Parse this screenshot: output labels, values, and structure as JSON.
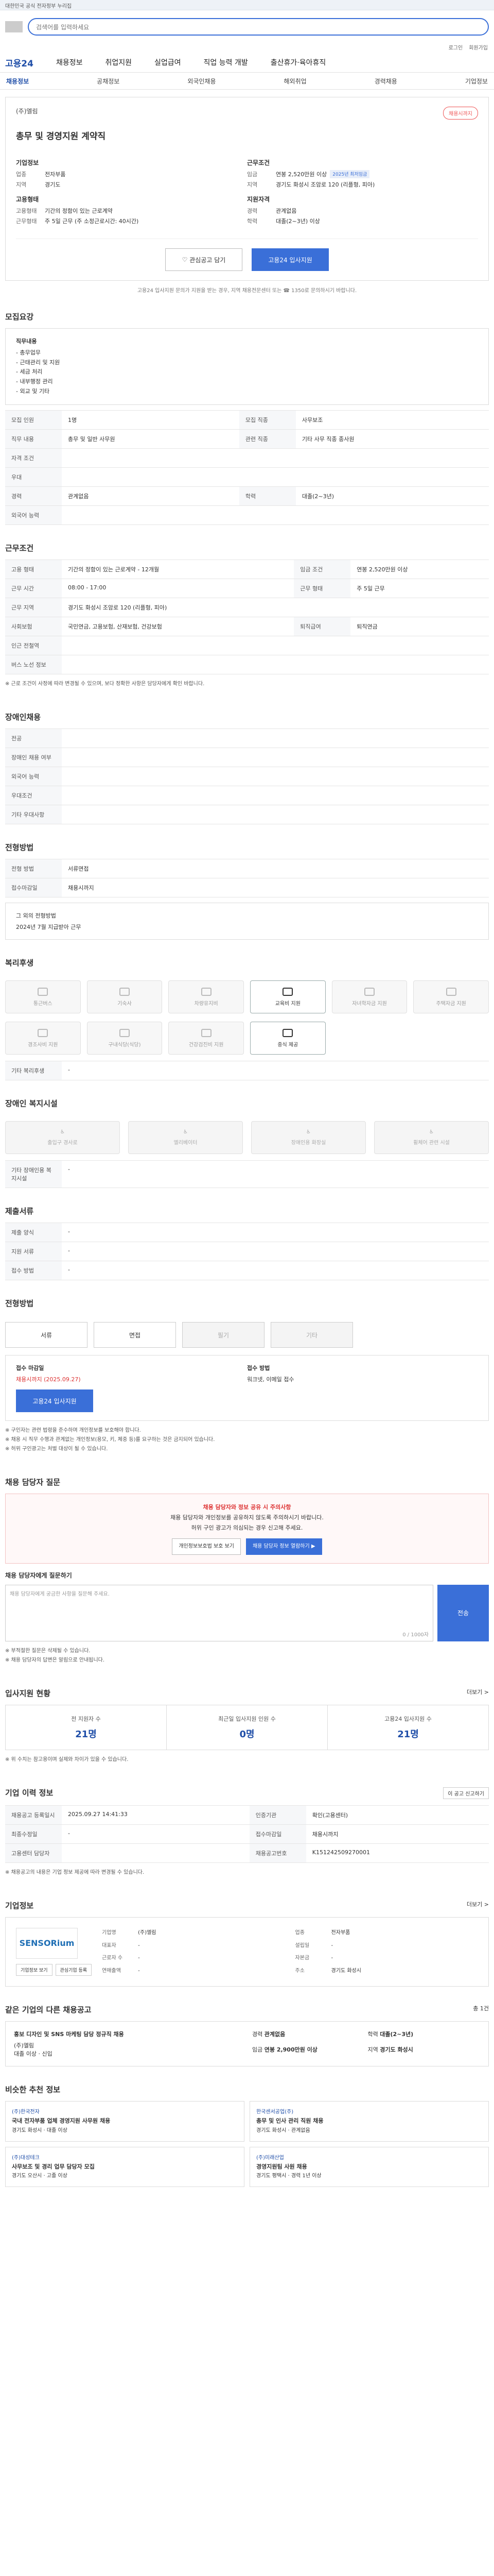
{
  "banner": "대한민국 공식 전자정부 누리집",
  "search": {
    "placeholder": "검색어를 입력하세요"
  },
  "util": [
    "로그인",
    "회원가입"
  ],
  "brand": {
    "logo": "고용24",
    "nav": [
      "채용정보",
      "취업지원",
      "실업급여",
      "직업 능력 개발",
      "출산휴가·육아휴직"
    ]
  },
  "subnav": [
    "채용정보",
    "공채정보",
    "외국인채용",
    "해외취업",
    "경력채용",
    "기업정보"
  ],
  "job": {
    "company": "(주)엘림",
    "badge": "채용시까지",
    "title": "총무 및 경영지원 계약직",
    "sect_company": "기업정보",
    "company_label": "업종",
    "company_val": "전자부품",
    "cn_label": "지역",
    "cn_val": "경기도",
    "sect_cond": "근무조건",
    "wage_label": "임금",
    "wage_val": "연봉 2,520만원 이상",
    "wage_tag": "2025년 최저임금",
    "loc_label": "지역",
    "loc_val": "경기도 화성시 조암로 120 (리플형, 피아)",
    "sect_type": "고용형태",
    "type_label": "고용형태",
    "type_val": "기간의 정함이 있는 근로계약",
    "form_label": "근무형태",
    "form_val": "주 5일 근무 (주 소정근로시간: 40시간)",
    "sect_req": "지원자격",
    "career_label": "경력",
    "career_val": "관계없음",
    "edu_label": "학력",
    "edu_val": "대졸(2~3년) 이상",
    "btn_interest": "관심공고 담기",
    "btn_apply": "고용24 입사지원",
    "note": "고용24 입사지원 문의가 지원을 받는 경우, 지역 채용전문센터 또는 ☎ 1350로 문의하시기 바랍니다."
  },
  "recruit": {
    "title": "모집요강",
    "duty_label": "직무내용",
    "duty_lines": [
      "- 총무업무",
      "- 근태관리 및 지원",
      "- 세금 처리",
      "- 내부행정 관리",
      "- 외교 및 기타"
    ],
    "rows": [
      [
        "모집 인원",
        "1명",
        "모집 직종",
        "사무보조"
      ],
      [
        "직무 내용",
        "총무 및 일반 사무원",
        "관련 직종",
        "기타 사무 직종 종사원"
      ],
      [
        "자격 조건",
        "",
        null,
        null
      ],
      [
        "우대",
        "",
        null,
        null
      ],
      [
        "경력",
        "관계없음",
        "학력",
        "대졸(2~3년)"
      ],
      [
        "외국어 능력",
        "",
        null,
        null
      ]
    ]
  },
  "cond": {
    "title": "근무조건",
    "rows": [
      [
        "고용 형태",
        "기간의 정함이 있는 근로계약 - 12개월",
        "임금 조건",
        "연봉 2,520만원 이상"
      ],
      [
        "근무 시간",
        "08:00 - 17:00",
        "근무 형태",
        "주 5일 근무"
      ],
      [
        "근무 지역",
        "경기도 화성시 조암로 120 (리플형, 피아)",
        "",
        ""
      ],
      [
        "사회보험",
        "국민연금, 고용보험, 산재보험, 건강보험",
        "퇴직급여",
        "퇴직연금"
      ],
      [
        "인근 전철역",
        "",
        "",
        ""
      ],
      [
        "버스 노선 정보",
        "",
        "",
        ""
      ]
    ],
    "note": "※ 근로 조건이 사정에 따라 변경될 수 있으며, 보다 정확한 사항은 담당자에게 확인 바랍니다."
  },
  "disability": {
    "title": "장애인채용",
    "rows": [
      [
        "전공",
        ""
      ],
      [
        "장애인 채용 여부",
        ""
      ],
      [
        "외국어 능력",
        ""
      ],
      [
        "우대조건",
        ""
      ],
      [
        "기타 우대사항",
        ""
      ]
    ]
  },
  "process": {
    "title": "전형방법",
    "rows": [
      [
        "전형 방법",
        "서류면접"
      ],
      [
        "접수마감일",
        "채용시까지"
      ]
    ],
    "note_title": "그 외의 전형방법",
    "note_body": "2024년 7월 지급받아 근무"
  },
  "welfare": {
    "title": "복리후생",
    "items": [
      "통근버스",
      "기숙사",
      "차량유지비",
      "교육비 지원",
      "자녀학자금 지원",
      "주택자금 지원",
      "경조사비 지원",
      "구내식당(식당)",
      "건강검진비 지원",
      "중식 제공"
    ],
    "on": [
      3,
      9
    ],
    "other_label": "기타 복리후생",
    "other_val": "-"
  },
  "disab_welfare": {
    "title": "장애인 복지시설",
    "items": [
      "출입구 경사로",
      "엘리베이터",
      "장애인용 화장실",
      "휠체어 관련 시설"
    ],
    "other_label": "기타 장애인용 복지시설",
    "other_val": "-"
  },
  "docs": {
    "title": "제출서류",
    "rows": [
      [
        "제출 양식",
        "-"
      ],
      [
        "지원 서류",
        "-"
      ],
      [
        "접수 방법",
        "-"
      ]
    ]
  },
  "apply": {
    "title": "전형방법",
    "methods": [
      "서류",
      "면접",
      "필기",
      "기타"
    ],
    "deadline_label": "접수 마감일",
    "deadline_val": "채용시까지 (2025.09.27)",
    "way_label": "접수 방법",
    "way_val": "워크넷, 이메일 접수",
    "btn_apply": "고용24 입사지원",
    "bullets": [
      "※ 구인자는 관련 법령을 준수하며 개인정보를 보호해야 합니다.",
      "※ 채용 시 직무 수행과 관계없는 개인정보(용모, 키, 체중 등)를 요구하는 것은 금지되어 있습니다.",
      "※ 허위 구인광고는 처벌 대상이 될 수 있습니다."
    ]
  },
  "qa": {
    "title": "채용 담당자 질문",
    "banner_line1": "채용 담당자와 정보 공유 시 주의사항",
    "banner_line2": "채용 담당자와 개인정보를 공유하지 않도록 주의하시기 바랍니다.",
    "banner_line3": "허위 구인 광고가 의심되는 경우 신고해 주세요.",
    "btns": [
      "개인정보보호법 보호 보기",
      "채용 담당자 정보 열람하기 ▶"
    ],
    "question_label": "채용 담당자에게 질문하기",
    "question_placeholder": "채용 담당자에게 궁금한 사항을 질문해 주세요.",
    "counter": "0 / 1000자",
    "send": "전송",
    "notes": [
      "※ 부적절한 질문은 삭제될 수 있습니다.",
      "※ 채용 담당자의 답변은 알림으로 안내됩니다."
    ]
  },
  "stats": {
    "title": "입사지원 현황",
    "more": "더보기 >",
    "items": [
      {
        "label": "전 지원자 수",
        "value": "21명"
      },
      {
        "label": "최근일 입사지원 인원 수",
        "value": "0명"
      },
      {
        "label": "고용24 입사지원 수",
        "value": "21명"
      }
    ],
    "note": "※ 위 수치는 참고용이며 실제와 차이가 있을 수 있습니다."
  },
  "regi": {
    "title": "기업 이력 정보",
    "btn": "이 공고 신고하기",
    "rows": [
      [
        "채용공고 등록일시",
        "2025.09.27 14:41:33",
        "인증기관",
        "확인(고용센터)"
      ],
      [
        "최종수정일",
        "-",
        "접수마감일",
        "채용시까지"
      ],
      [
        "고용센터 담당자",
        "",
        "채용공고번호",
        "K151242509270001"
      ]
    ],
    "note": "※ 채용공고의 내용은 기업 정보 제공에 따라 변경될 수 있습니다."
  },
  "company": {
    "title": "기업정보",
    "more": "더보기 >",
    "logo": "SENSORium",
    "btns": [
      "기업정보 보기",
      "관심기업 등록"
    ],
    "fields": [
      [
        "기업명",
        "(주)엘림"
      ],
      [
        "업종",
        "전자부품"
      ],
      [
        "대표자",
        "-"
      ],
      [
        "설립일",
        "-"
      ],
      [
        "근로자 수",
        "-"
      ],
      [
        "자본금",
        "-"
      ],
      [
        "연매출액",
        "-"
      ],
      [
        "주소",
        "경기도 화성시"
      ]
    ]
  },
  "other": {
    "title": "같은 기업의 다른 채용공고",
    "subtitle": "총 1건",
    "left_title": "홍보 디자인 및 SNS 마케팅 담당 정규직 채용",
    "left_lines": [
      "(주)엘림",
      "대졸 이상 · 신입"
    ],
    "right": [
      "경력",
      "관계없음",
      "학력",
      "대졸(2~3년)",
      "임금",
      "연봉 2,900만원 이상",
      "지역",
      "경기도 화성시"
    ]
  },
  "similar": {
    "title": "비슷한 추천 정보",
    "jobs": [
      {
        "co": "(주)한국전자",
        "t": "국내 전자부품 업체 경영지원 사무원 채용",
        "meta": "경기도 화성시 · 대졸 이상"
      },
      {
        "co": "한국센서공업(주)",
        "t": "총무 및 인사 관리 직원 채용",
        "meta": "경기도 화성시 · 관계없음"
      },
      {
        "co": "(주)대성테크",
        "t": "사무보조 및 경리 업무 담당자 모집",
        "meta": "경기도 오산시 · 고졸 이상"
      },
      {
        "co": "(주)미래산업",
        "t": "경영지원팀 사원 채용",
        "meta": "경기도 평택시 · 경력 1년 이상"
      }
    ]
  }
}
